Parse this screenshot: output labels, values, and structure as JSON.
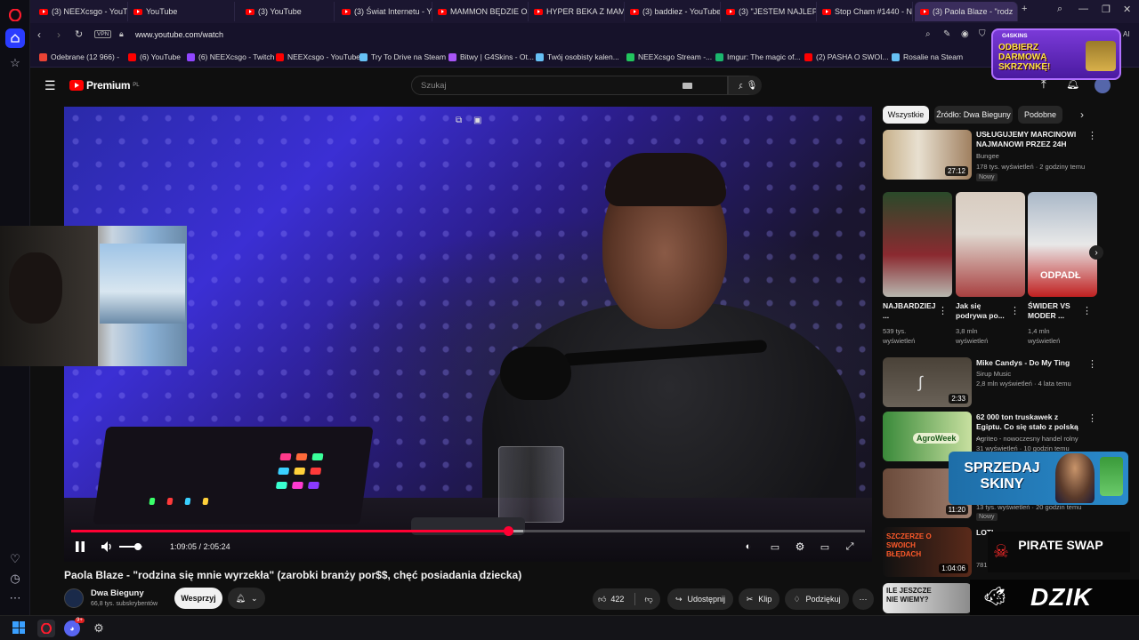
{
  "browser": {
    "tabs": [
      {
        "label": "(3) NEEXcsgo - YouTube",
        "favicon": "youtube"
      },
      {
        "label": "YouTube",
        "favicon": "youtube"
      },
      {
        "label": "(3) YouTube",
        "favicon": "youtube"
      },
      {
        "label": "(3) Świat Internetu - You",
        "favicon": "youtube"
      },
      {
        "label": "MAMMON BĘDZIE OJCE",
        "favicon": "youtube"
      },
      {
        "label": "HYPER BEKA Z MAMMO",
        "favicon": "youtube"
      },
      {
        "label": "(3) baddiez - YouTube",
        "favicon": "youtube"
      },
      {
        "label": "(3) \"JESTEM NAJLEPSZY",
        "favicon": "youtube"
      },
      {
        "label": "Stop Cham #1440 - Niel",
        "favicon": "youtube"
      },
      {
        "label": "(3) Paola Blaze - \"rodz",
        "favicon": "youtube",
        "active": true
      }
    ],
    "vpn_label": "VPN",
    "url": "www.youtube.com/watch",
    "right_label": "AI",
    "bookmarks": [
      {
        "label": "Odebrane (12 966) -",
        "color": "#ea4335"
      },
      {
        "label": "(6) YouTube",
        "color": "#ff0000"
      },
      {
        "label": "(6) NEEXcsgo - Twitch",
        "color": "#9146ff"
      },
      {
        "label": "NEEXcsgo - YouTube",
        "color": "#ff0000"
      },
      {
        "label": "Try To Drive na Steam",
        "color": "#66c0f4"
      },
      {
        "label": "Bitwy | G4Skins - Ot...",
        "color": "#a855f7"
      },
      {
        "label": "Twój osobisty kalen...",
        "color": "#66c0f4"
      },
      {
        "label": "NEEXcsgo Stream -...",
        "color": "#22c55e"
      },
      {
        "label": "Imgur: The magic of...",
        "color": "#1bb76e"
      },
      {
        "label": "(2) PASHA O SWOI...",
        "color": "#ff0000"
      },
      {
        "label": "Rosalie na Steam",
        "color": "#66c0f4"
      }
    ]
  },
  "youtube": {
    "logo_text": "Premium",
    "logo_region": "PL",
    "search_placeholder": "Szukaj",
    "notifications_count": "9+"
  },
  "video": {
    "current_time": "1:09:05",
    "separator": "/",
    "duration": "2:05:24",
    "progress": 0.551,
    "buffered": 0.57,
    "volume": 0.8,
    "title": "Paola Blaze - \"rodzina się mnie wyrzekła\" (zarobki branży por$$, chęć posiadania dziecka)",
    "channel_name": "Dwa Bieguny",
    "subscribers": "66,8 tys. subskrybentów",
    "support_label": "Wesprzyj",
    "likes": "422",
    "share_label": "Udostępnij",
    "clip_label": "Klip",
    "thanks_label": "Podziękuj"
  },
  "sidebar": {
    "chips": [
      "Wszystkie",
      "Źródło: Dwa Bieguny",
      "Podobne"
    ],
    "recommendations": [
      {
        "title": "USŁUGUJEMY MARCINOWI NAJMANOWI PRZEZ 24H",
        "channel": "Bungee",
        "meta": "178 tys. wyświetleń · 2 godziny temu",
        "badge": "Nowy",
        "duration": "27:12"
      },
      {
        "title": "Mike Candys - Do My Ting",
        "channel": "Sirup Music",
        "meta": "2,8 mln wyświetleń · 4 lata temu",
        "duration": "2:33"
      },
      {
        "title": "62 000 ton truskawek z Egiptu. Co się stało z polską ...",
        "channel": "Agriteo - nowoczesny handel rolny",
        "meta": "31 wyświetleń · 10 godzin temu",
        "thumb_text": "AgroWeek"
      },
      {
        "title": "",
        "meta": "13 tys. wyświetleń · 20 godzin temu",
        "badge": "Nowy",
        "duration": "11:20"
      },
      {
        "title": "LOTI...",
        "meta": "781 t...",
        "duration": "1:04:06",
        "thumb_text": "SZCZERZE O SWOICH BŁĘDACH"
      },
      {
        "title": "",
        "meta": "",
        "thumb_text": "ILE JESZCZE NIE WIEMY?"
      }
    ],
    "shorts": [
      {
        "title": "NAJBARDZIEJ ...",
        "views": "539 tys. wyświetleń"
      },
      {
        "title": "Jak się podrywa po...",
        "views": "3,8 mln wyświetleń"
      },
      {
        "title": "ŚWIDER VS MODER ...",
        "views": "1,4 mln wyświetleń",
        "thumb_text": "ODPADŁ"
      }
    ]
  },
  "ads": {
    "top_brand": "G4SKINS",
    "top_text": "ODBIERZ DARMOWĄ SKRZYNKĘ!",
    "mid_text": "SPRZEDAJ SKINY",
    "pirate_text": "PIRATE SWAP",
    "dzik_text": "DZIK"
  },
  "colors": {
    "accent": "#ff0033",
    "opera": "#ff1b2d",
    "browser_bg": "#1b1630"
  }
}
